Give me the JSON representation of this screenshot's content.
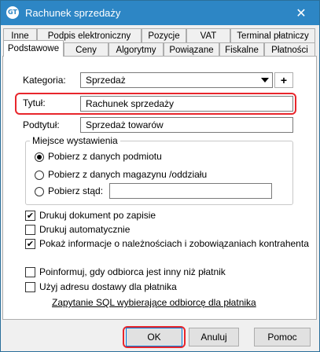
{
  "window": {
    "title": "Rachunek sprzedaży",
    "icon": "GT",
    "close_glyph": "✕"
  },
  "tabs_row1": [
    {
      "label": "Inne"
    },
    {
      "label": "Podpis elektroniczny"
    },
    {
      "label": "Pozycje"
    },
    {
      "label": "VAT"
    },
    {
      "label": "Terminal płatniczy"
    }
  ],
  "tabs_row2": [
    {
      "label": "Podstawowe",
      "active": true
    },
    {
      "label": "Ceny"
    },
    {
      "label": "Algorytmy"
    },
    {
      "label": "Powiązane"
    },
    {
      "label": "Fiskalne"
    },
    {
      "label": "Płatności"
    }
  ],
  "form": {
    "kategoria_label": "Kategoria:",
    "kategoria_value": "Sprzedaż",
    "plus_label": "+",
    "tytul_label": "Tytuł:",
    "tytul_value": "Rachunek sprzedaży",
    "podtytul_label": "Podtytuł:",
    "podtytul_value": "Sprzedaż towarów"
  },
  "issue_place": {
    "group_title": "Miejsce wystawienia",
    "options": [
      {
        "label": "Pobierz z danych podmiotu",
        "selected": true
      },
      {
        "label": "Pobierz z danych magazynu /oddziału",
        "selected": false
      },
      {
        "label": "Pobierz stąd:",
        "selected": false
      }
    ],
    "custom_value": ""
  },
  "checks": [
    {
      "label": "Drukuj dokument po zapisie",
      "checked": true
    },
    {
      "label": "Drukuj automatycznie",
      "checked": false
    },
    {
      "label": "Pokaż informacje o należnościach i zobowiązaniach kontrahenta",
      "checked": true
    },
    {
      "label": "Poinformuj, gdy odbiorca jest inny niż płatnik",
      "checked": false
    },
    {
      "label": "Użyj adresu dostawy dla płatnika",
      "checked": false
    }
  ],
  "check_glyph": "✔",
  "link": "Zapytanie SQL wybierające odbiorcę dla płatnika",
  "buttons": {
    "ok": "OK",
    "cancel": "Anuluj",
    "help": "Pomoc"
  },
  "colors": {
    "titlebar": "#2d86c5",
    "highlight": "#e8262c",
    "default_button_border": "#0078d7"
  }
}
